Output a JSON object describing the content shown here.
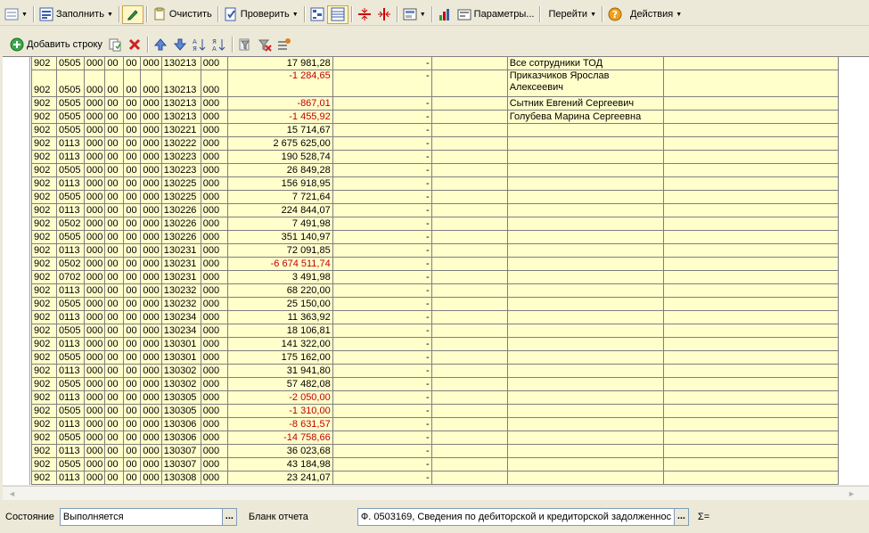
{
  "toolbar": {
    "fill_label": "Заполнить",
    "clear_label": "Очистить",
    "check_label": "Проверить",
    "params_label": "Параметры...",
    "goto_label": "Перейти",
    "actions_label": "Действия"
  },
  "subtoolbar": {
    "add_row_label": "Добавить строку"
  },
  "table": {
    "rows": [
      {
        "c": [
          "902",
          "0505",
          "000",
          "00",
          "00",
          "000",
          "130213",
          "000"
        ],
        "amount": "17 981,28",
        "neg": false,
        "dash": "-",
        "name": "Все сотрудники ТОД"
      },
      {
        "c": [
          "902",
          "0505",
          "000",
          "00",
          "00",
          "000",
          "130213",
          "000"
        ],
        "amount": "-1 284,65",
        "neg": true,
        "dash": "-",
        "name": "Приказчиков Ярослав Алексеевич",
        "tall": true
      },
      {
        "c": [
          "902",
          "0505",
          "000",
          "00",
          "00",
          "000",
          "130213",
          "000"
        ],
        "amount": "-867,01",
        "neg": true,
        "dash": "-",
        "name": "Сытник Евгений Сергеевич"
      },
      {
        "c": [
          "902",
          "0505",
          "000",
          "00",
          "00",
          "000",
          "130213",
          "000"
        ],
        "amount": "-1 455,92",
        "neg": true,
        "dash": "-",
        "name": "Голубева Марина Сергеевна"
      },
      {
        "c": [
          "902",
          "0505",
          "000",
          "00",
          "00",
          "000",
          "130221",
          "000"
        ],
        "amount": "15 714,67",
        "neg": false,
        "dash": "-",
        "name": ""
      },
      {
        "c": [
          "902",
          "0113",
          "000",
          "00",
          "00",
          "000",
          "130222",
          "000"
        ],
        "amount": "2 675 625,00",
        "neg": false,
        "dash": "-",
        "name": ""
      },
      {
        "c": [
          "902",
          "0113",
          "000",
          "00",
          "00",
          "000",
          "130223",
          "000"
        ],
        "amount": "190 528,74",
        "neg": false,
        "dash": "-",
        "name": ""
      },
      {
        "c": [
          "902",
          "0505",
          "000",
          "00",
          "00",
          "000",
          "130223",
          "000"
        ],
        "amount": "26 849,28",
        "neg": false,
        "dash": "-",
        "name": ""
      },
      {
        "c": [
          "902",
          "0113",
          "000",
          "00",
          "00",
          "000",
          "130225",
          "000"
        ],
        "amount": "156 918,95",
        "neg": false,
        "dash": "-",
        "name": ""
      },
      {
        "c": [
          "902",
          "0505",
          "000",
          "00",
          "00",
          "000",
          "130225",
          "000"
        ],
        "amount": "7 721,64",
        "neg": false,
        "dash": "-",
        "name": ""
      },
      {
        "c": [
          "902",
          "0113",
          "000",
          "00",
          "00",
          "000",
          "130226",
          "000"
        ],
        "amount": "224 844,07",
        "neg": false,
        "dash": "-",
        "name": ""
      },
      {
        "c": [
          "902",
          "0502",
          "000",
          "00",
          "00",
          "000",
          "130226",
          "000"
        ],
        "amount": "7 491,98",
        "neg": false,
        "dash": "-",
        "name": ""
      },
      {
        "c": [
          "902",
          "0505",
          "000",
          "00",
          "00",
          "000",
          "130226",
          "000"
        ],
        "amount": "351 140,97",
        "neg": false,
        "dash": "-",
        "name": ""
      },
      {
        "c": [
          "902",
          "0113",
          "000",
          "00",
          "00",
          "000",
          "130231",
          "000"
        ],
        "amount": "72 091,85",
        "neg": false,
        "dash": "-",
        "name": ""
      },
      {
        "c": [
          "902",
          "0502",
          "000",
          "00",
          "00",
          "000",
          "130231",
          "000"
        ],
        "amount": "-6 674 511,74",
        "neg": true,
        "dash": "-",
        "name": ""
      },
      {
        "c": [
          "902",
          "0702",
          "000",
          "00",
          "00",
          "000",
          "130231",
          "000"
        ],
        "amount": "3 491,98",
        "neg": false,
        "dash": "-",
        "name": ""
      },
      {
        "c": [
          "902",
          "0113",
          "000",
          "00",
          "00",
          "000",
          "130232",
          "000"
        ],
        "amount": "68 220,00",
        "neg": false,
        "dash": "-",
        "name": ""
      },
      {
        "c": [
          "902",
          "0505",
          "000",
          "00",
          "00",
          "000",
          "130232",
          "000"
        ],
        "amount": "25 150,00",
        "neg": false,
        "dash": "-",
        "name": ""
      },
      {
        "c": [
          "902",
          "0113",
          "000",
          "00",
          "00",
          "000",
          "130234",
          "000"
        ],
        "amount": "11 363,92",
        "neg": false,
        "dash": "-",
        "name": ""
      },
      {
        "c": [
          "902",
          "0505",
          "000",
          "00",
          "00",
          "000",
          "130234",
          "000"
        ],
        "amount": "18 106,81",
        "neg": false,
        "dash": "-",
        "name": ""
      },
      {
        "c": [
          "902",
          "0113",
          "000",
          "00",
          "00",
          "000",
          "130301",
          "000"
        ],
        "amount": "141 322,00",
        "neg": false,
        "dash": "-",
        "name": ""
      },
      {
        "c": [
          "902",
          "0505",
          "000",
          "00",
          "00",
          "000",
          "130301",
          "000"
        ],
        "amount": "175 162,00",
        "neg": false,
        "dash": "-",
        "name": ""
      },
      {
        "c": [
          "902",
          "0113",
          "000",
          "00",
          "00",
          "000",
          "130302",
          "000"
        ],
        "amount": "31 941,80",
        "neg": false,
        "dash": "-",
        "name": ""
      },
      {
        "c": [
          "902",
          "0505",
          "000",
          "00",
          "00",
          "000",
          "130302",
          "000"
        ],
        "amount": "57 482,08",
        "neg": false,
        "dash": "-",
        "name": ""
      },
      {
        "c": [
          "902",
          "0113",
          "000",
          "00",
          "00",
          "000",
          "130305",
          "000"
        ],
        "amount": "-2 050,00",
        "neg": true,
        "dash": "-",
        "name": ""
      },
      {
        "c": [
          "902",
          "0505",
          "000",
          "00",
          "00",
          "000",
          "130305",
          "000"
        ],
        "amount": "-1 310,00",
        "neg": true,
        "dash": "-",
        "name": ""
      },
      {
        "c": [
          "902",
          "0113",
          "000",
          "00",
          "00",
          "000",
          "130306",
          "000"
        ],
        "amount": "-8 631,57",
        "neg": true,
        "dash": "-",
        "name": ""
      },
      {
        "c": [
          "902",
          "0505",
          "000",
          "00",
          "00",
          "000",
          "130306",
          "000"
        ],
        "amount": "-14 758,66",
        "neg": true,
        "dash": "-",
        "name": ""
      },
      {
        "c": [
          "902",
          "0113",
          "000",
          "00",
          "00",
          "000",
          "130307",
          "000"
        ],
        "amount": "36 023,68",
        "neg": false,
        "dash": "-",
        "name": ""
      },
      {
        "c": [
          "902",
          "0505",
          "000",
          "00",
          "00",
          "000",
          "130307",
          "000"
        ],
        "amount": "43 184,98",
        "neg": false,
        "dash": "-",
        "name": ""
      },
      {
        "c": [
          "902",
          "0113",
          "000",
          "00",
          "00",
          "000",
          "130308",
          "000"
        ],
        "amount": "23 241,07",
        "neg": false,
        "dash": "-",
        "name": ""
      }
    ]
  },
  "status": {
    "state_label": "Состояние",
    "state_value": "Выполняется",
    "form_label": "Бланк отчета",
    "form_value": "Ф. 0503169, Сведения по дебиторской и кредиторской задолженнос",
    "dots": "...",
    "sum_label": "Σ="
  },
  "colors": {
    "cell_bg": "#ffffcc",
    "negative": "#c00000",
    "chrome": "#ece9d8"
  }
}
